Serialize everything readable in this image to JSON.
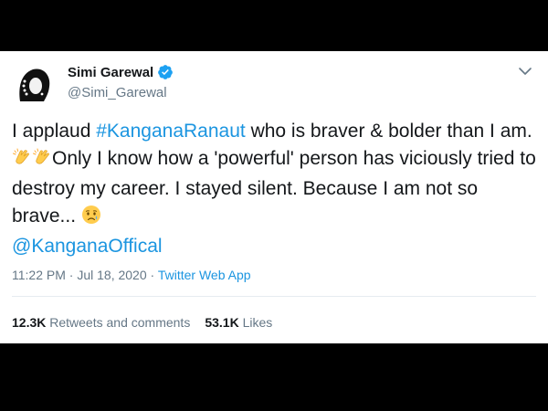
{
  "tweet": {
    "author": {
      "display_name": "Simi Garewal",
      "handle": "@Simi_Garewal",
      "verified": true
    },
    "body": {
      "part1": "I applaud ",
      "hashtag": "#KanganaRanaut",
      "part2": " who is braver & bolder than I am. ",
      "part3": "Only I know how a 'powerful' person has viciously tried to destroy my career. I stayed silent. Because I am not so brave... ",
      "mention": "@KanganaOffical"
    },
    "meta": {
      "time": "11:22 PM",
      "separator": " · ",
      "date": "Jul 18, 2020",
      "source": "Twitter Web App"
    },
    "stats": {
      "retweets_count": "12.3K",
      "retweets_label": " Retweets and comments",
      "likes_count": "53.1K",
      "likes_label": " Likes"
    }
  },
  "icons": {
    "verified": "verified-badge-icon",
    "caret": "chevron-down-icon",
    "emoji_clap": "clapping-hands-emoji",
    "emoji_sad": "sad-but-relieved-face-emoji"
  },
  "colors": {
    "link": "#1b95e0",
    "text": "#14171a",
    "secondary": "#657786",
    "background_frame": "#000000"
  }
}
